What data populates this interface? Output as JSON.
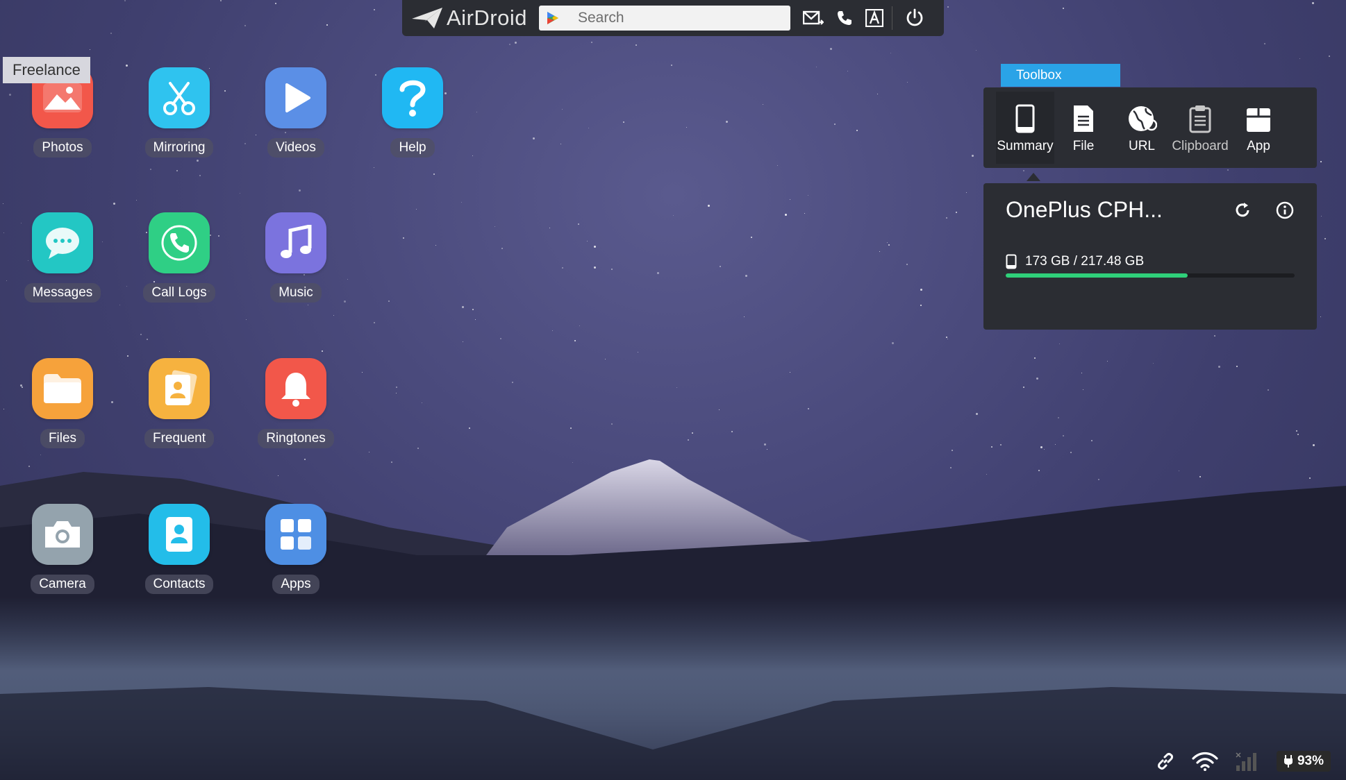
{
  "topbar": {
    "logo_text": "AirDroid",
    "search_placeholder": "Search"
  },
  "freelance_label": "Freelance",
  "apps": [
    {
      "label": "Photos",
      "icon": "photos-icon",
      "color": "#f2574a"
    },
    {
      "label": "Mirroring",
      "icon": "scissors-icon",
      "color": "#2fc3ef"
    },
    {
      "label": "Videos",
      "icon": "play-icon",
      "color": "#5b8fe6"
    },
    {
      "label": "Help",
      "icon": "question-icon",
      "color": "#20b8f3"
    },
    {
      "label": "Messages",
      "icon": "chat-bubble-icon",
      "color": "#23c7c4"
    },
    {
      "label": "Call Logs",
      "icon": "phone-icon",
      "color": "#2fcf85"
    },
    {
      "label": "Music",
      "icon": "music-note-icon",
      "color": "#7b73de"
    },
    {
      "label": "Files",
      "icon": "folder-icon",
      "color": "#f6a23b"
    },
    {
      "label": "Frequent",
      "icon": "contact-card-icon",
      "color": "#f6b23f"
    },
    {
      "label": "Ringtones",
      "icon": "bell-icon",
      "color": "#f2574a"
    },
    {
      "label": "Camera",
      "icon": "camera-icon",
      "color": "#94a3ad"
    },
    {
      "label": "Contacts",
      "icon": "contacts-book-icon",
      "color": "#23bde9"
    },
    {
      "label": "Apps",
      "icon": "apps-grid-icon",
      "color": "#4e8fe4"
    }
  ],
  "toolbox": {
    "title": "Toolbox",
    "tools": [
      {
        "label": "Summary",
        "icon": "phone-device-icon"
      },
      {
        "label": "File",
        "icon": "file-icon"
      },
      {
        "label": "URL",
        "icon": "globe-icon"
      },
      {
        "label": "Clipboard",
        "icon": "clipboard-icon"
      },
      {
        "label": "App",
        "icon": "app-box-icon"
      }
    ]
  },
  "device": {
    "name": "OnePlus CPH...",
    "storage_text": "173 GB / 217.48 GB",
    "storage_fraction": 0.63,
    "bar_color": "#2fd07a"
  },
  "statusbar": {
    "battery": "93%"
  }
}
